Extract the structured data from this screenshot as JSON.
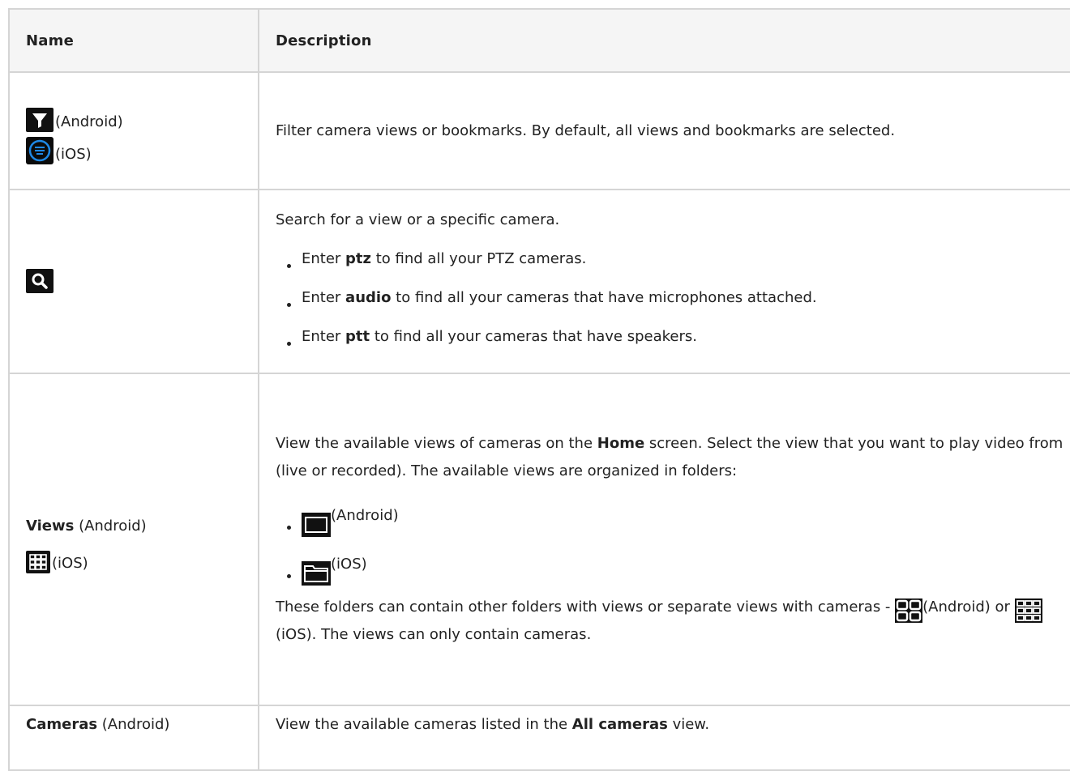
{
  "header": {
    "name": "Name",
    "description": "Description"
  },
  "rows": {
    "filter": {
      "android_label": "(Android)",
      "ios_label": "(iOS)",
      "description": "Filter camera views or bookmarks. By default, all views and bookmarks are selected.",
      "icons": [
        "filter-funnel-icon",
        "filter-circle-icon"
      ]
    },
    "search": {
      "icon": "search-icon",
      "intro": "Search for a view or a specific camera.",
      "bullets": [
        {
          "pre": "Enter ",
          "bold": "ptz",
          "post": " to find all your PTZ cameras."
        },
        {
          "pre": "Enter ",
          "bold": "audio",
          "post": " to find all your cameras that have microphones attached."
        },
        {
          "pre": "Enter ",
          "bold": "ptt",
          "post": " to find all your cameras that have speakers."
        }
      ]
    },
    "views": {
      "name_bold": "Views",
      "name_android": " (Android)",
      "ios_label": "(iOS)",
      "intro_pre": "View the available views of cameras on the ",
      "intro_bold": "Home",
      "intro_post": " screen. Select the view that you want to play video from (live or recorded). The available views are organized in folders:",
      "folder_android_label": "(Android)",
      "folder_ios_label": "(iOS)",
      "outro_pre": "These folders can contain other folders with views or separate views with cameras - ",
      "outro_android": "(Android) or ",
      "outro_ios": "(iOS). The views can only contain cameras."
    },
    "cameras": {
      "name_bold": "Cameras",
      "name_android": " (Android)",
      "desc_pre": "View the available cameras listed in the ",
      "desc_bold": "All cameras",
      "desc_post": " view."
    }
  },
  "colors": {
    "header_bg": "#f5f5f5",
    "border": "#d5d5d5",
    "icon_bg": "#111111",
    "ios_accent": "#1e88e5"
  }
}
